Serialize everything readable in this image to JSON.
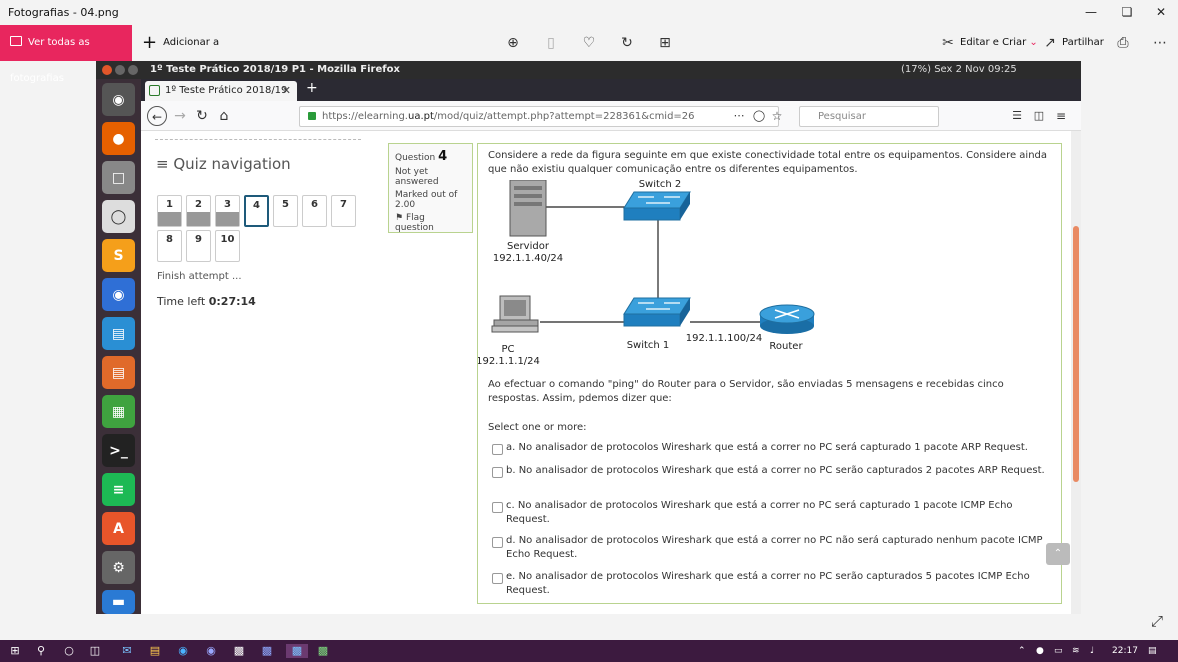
{
  "app": {
    "window_title": "Fotografias - 04.png",
    "see_all_label": "Ver todas as fotografias",
    "add_to_label": "Adicionar a",
    "edit_create_label": "Editar e Criar",
    "share_label": "Partilhar"
  },
  "ubuntu": {
    "window_title": "1º Teste Prático 2018/19 P1 - Mozilla Firefox",
    "status": "(17%)   Sex 2 Nov 09:25"
  },
  "firefox": {
    "tab_title": "1º Teste Prático 2018/19",
    "url_prefix": "https://elearning.",
    "url_domain": "ua.pt",
    "url_rest": "/mod/quiz/attempt.php?attempt=228361&cmid=26",
    "search_placeholder": "Pesquisar"
  },
  "quiz_nav": {
    "heading": "Quiz navigation",
    "buttons": [
      "1",
      "2",
      "3",
      "4",
      "5",
      "6",
      "7",
      "8",
      "9",
      "10"
    ],
    "finish_label": "Finish attempt ...",
    "time_left_label": "Time left",
    "time_left_value": "0:27:14"
  },
  "question_info": {
    "question_label": "Question",
    "number": "4",
    "status": "Not yet answered",
    "marked_out_of": "Marked out of",
    "marks": "2.00",
    "flag_label": "Flag question"
  },
  "question": {
    "intro": "Considere a rede da figura seguinte em que existe conectividade total entre os equipamentos. Considere ainda que não existiu qualquer comunicação entre os diferentes equipamentos.",
    "diagram": {
      "server_label": "Servidor",
      "server_ip": "192.1.1.40/24",
      "switch2_label": "Switch 2",
      "switch1_label": "Switch 1",
      "pc_label": "PC",
      "pc_ip": "192.1.1.1/24",
      "router_label": "Router",
      "router_ip": "192.1.1.100/24"
    },
    "body": "Ao efectuar o comando \"ping\" do Router para o Servidor, são enviadas 5 mensagens e recebidas cinco respostas. Assim, pdemos dizer que:",
    "select_label": "Select one or more:",
    "options": [
      "a. No analisador de protocolos Wireshark que está a correr no PC será capturado 1 pacote ARP Request.",
      "b. No analisador de protocolos Wireshark que está a correr no PC serão capturados 2 pacotes ARP Request.",
      "c. No analisador de protocolos Wireshark que está a correr no PC será capturado 1 pacote ICMP Echo Request.",
      "d. No analisador de protocolos Wireshark que está a correr no PC não será capturado nenhum pacote ICMP Echo Request.",
      "e. No analisador de protocolos Wireshark que está a correr no PC serão capturados 5 pacotes ICMP Echo Request."
    ]
  },
  "taskbar": {
    "time": "22:17"
  }
}
